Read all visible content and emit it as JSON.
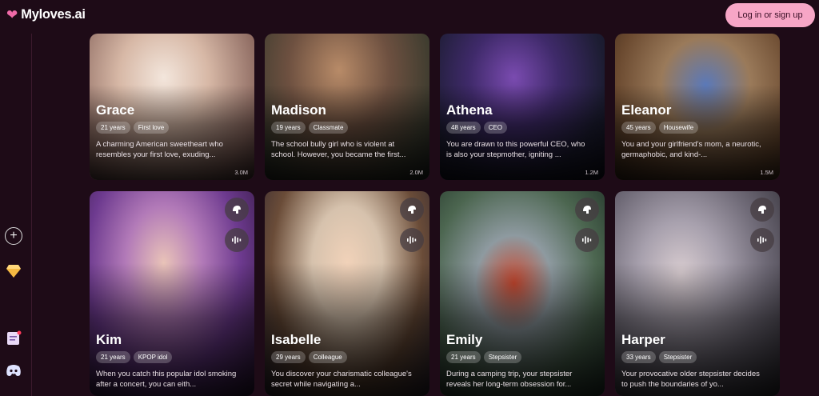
{
  "app": {
    "name": "Myloves.ai",
    "login_label": "Log in or sign up"
  },
  "sidebar": {
    "icons": [
      "plus-icon",
      "diamond-icon",
      "note-icon",
      "discord-icon"
    ]
  },
  "cards_top": [
    {
      "name": "Grace",
      "age": "21 years",
      "tag": "First love",
      "desc": "A charming American sweetheart who resembles your first love, exuding...",
      "count": "3.0M"
    },
    {
      "name": "Madison",
      "age": "19 years",
      "tag": "Classmate",
      "desc": "The school bully girl who is violent at school. However, you became the first...",
      "count": "2.0M"
    },
    {
      "name": "Athena",
      "age": "48 years",
      "tag": "CEO",
      "desc": "You are drawn to this powerful CEO, who is also your stepmother, igniting ...",
      "count": "1.2M"
    },
    {
      "name": "Eleanor",
      "age": "45 years",
      "tag": "Housewife",
      "desc": "You and your girlfriend's mom, a neurotic, germaphobic, and kind-...",
      "count": "1.5M"
    }
  ],
  "cards_bottom": [
    {
      "name": "Kim",
      "age": "21 years",
      "tag": "KPOP idol",
      "desc": "When you catch this popular idol smoking after a concert, you can eith..."
    },
    {
      "name": "Isabelle",
      "age": "29 years",
      "tag": "Colleague",
      "desc": "You discover your charismatic colleague's secret while navigating a..."
    },
    {
      "name": "Emily",
      "age": "21 years",
      "tag": "Stepsister",
      "desc": "During a camping trip, your stepsister reveals her long-term obsession for..."
    },
    {
      "name": "Harper",
      "age": "33 years",
      "tag": "Stepsister",
      "desc": "Your provocative older stepsister decides to push the boundaries of yo..."
    }
  ],
  "colors": {
    "background": "#1e0b17",
    "accent": "#f7a6c6"
  }
}
